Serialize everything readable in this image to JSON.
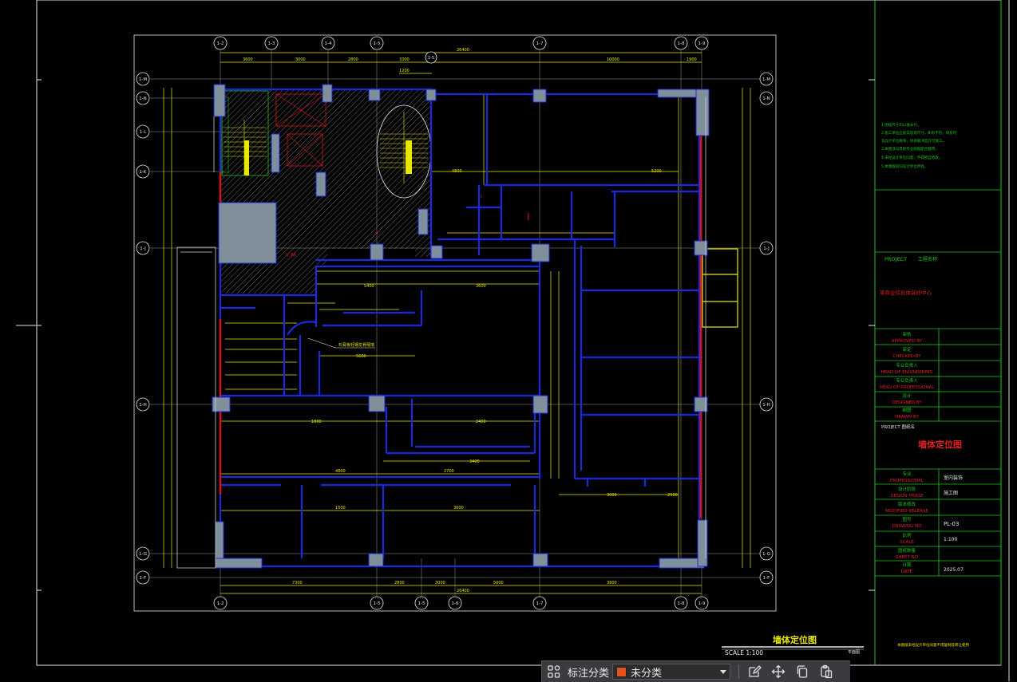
{
  "drawing": {
    "grid_labels_top": [
      "1-2",
      "1-3",
      "1-4",
      "1-5",
      "1-7",
      "1-8",
      "1-9"
    ],
    "grid_labels_bottom": [
      "1-2",
      "1-5",
      "1-5",
      "1-6",
      "1-7",
      "1-8",
      "1-9"
    ],
    "grid_labels_left": [
      "1-M",
      "1-N",
      "1-L",
      "1-K",
      "1-J",
      "1-H",
      "1-G",
      "1-F"
    ],
    "grid_labels_right": [
      "1-M",
      "1-N",
      "1-J",
      "1-H",
      "1-G",
      "1-F"
    ],
    "title": "墙体定位图",
    "scale": "SCALE 1:100",
    "scale_note": "平面图",
    "callout": "石膏板轻钢龙骨隔墙",
    "notes": [
      "1.图纸尺寸均以毫米计。",
      "2.施工单位应核实现场尺寸，如有不符，请及时",
      "  与设计单位联系，协商解决后方可施工。",
      "3.本图须与其他专业图纸配合使用。",
      "4.未经设计单位同意，不得擅自修改。",
      "5.本图版权归设计单位所有。"
    ],
    "dims_top": [
      "3600",
      "3000",
      "2800",
      "3300",
      "10000",
      "1900"
    ],
    "dims_top_total": "26400",
    "dims_bottom": [
      "7300",
      "2800",
      "3000",
      "5000",
      "3800"
    ],
    "dims_bottom_total": "26400",
    "dims_misc": [
      "1200",
      "5400",
      "3600",
      "4800",
      "5200",
      "3400",
      "2400",
      "1800",
      "3000",
      "1500",
      "4800",
      "2700",
      "3000",
      "5600",
      "2900"
    ]
  },
  "title_block": {
    "project_label": "PROJECT",
    "project_value": "工程名称",
    "client_name": "某商业综合体装修中心",
    "rows": [
      {
        "cn": "审核",
        "en": "APPROVED BY"
      },
      {
        "cn": "审定",
        "en": "CHECKED BY"
      },
      {
        "cn": "专业负责人",
        "en": "HEAD OF ENGINEERING"
      },
      {
        "cn": "专业负责人",
        "en": "HEAD OF PROFESSIONAL"
      },
      {
        "cn": "设计",
        "en": "DESIGNED BY"
      },
      {
        "cn": "制图",
        "en": "DRAWN BY"
      }
    ],
    "drawing_label": "PROJECT 图纸名",
    "drawing_title": "墙体定位图",
    "info_rows": [
      {
        "cn": "专业",
        "en": "PROFESSIONAL",
        "value": "室内装饰"
      },
      {
        "cn": "设计阶段",
        "en": "DESIGN PHASE",
        "value": "施工图"
      },
      {
        "cn": "版本修改",
        "en": "MODIFIED RELEASE",
        "value": ""
      },
      {
        "cn": "图号",
        "en": "DRAWING NO",
        "value": "PL-03"
      },
      {
        "cn": "比例",
        "en": "SCALE",
        "value": "1:100"
      },
      {
        "cn": "图纸数量",
        "en": "SHEET NO",
        "value": ""
      },
      {
        "cn": "日期",
        "en": "DATE",
        "value": "2025.07"
      }
    ],
    "footer": "本图纸未经设计单位同意不得复制及转让使用"
  },
  "toolbar": {
    "label": "标注分类",
    "selected": "未分类",
    "swatch_color": "#e2541b",
    "icons": [
      "grid-icon",
      "edit-icon",
      "move-icon",
      "copy-icon",
      "paste-icon"
    ]
  },
  "colors": {
    "background": "#000000",
    "wall": "#1a2ae0",
    "column": "#8a9aa5",
    "dimension": "#e8e800",
    "frame_green": "#18c818",
    "grid_line": "#e6e6e6",
    "red_wall": "#e01010",
    "text_red": "#e02020"
  }
}
